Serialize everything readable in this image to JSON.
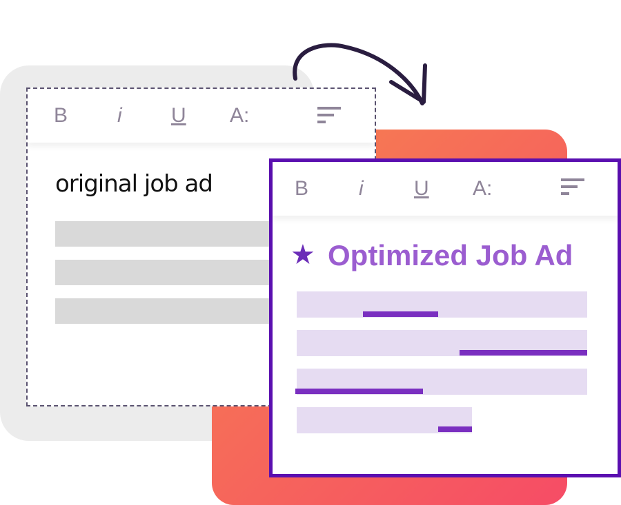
{
  "original": {
    "title": "original job ad",
    "toolbar": [
      "B",
      "i",
      "U",
      "A:"
    ]
  },
  "optimized": {
    "title": "Optimized Job Ad",
    "toolbar": [
      "B",
      "i",
      "U",
      "A:"
    ]
  },
  "icons": [
    "arrow-curved-icon",
    "star-icon",
    "align-icon"
  ],
  "colors": {
    "frame": "#5a0fb0",
    "accent": "#9b5dd0",
    "highlight": "#7a2fc0",
    "orange_start": "#f6834f",
    "orange_end": "#f64c66"
  }
}
